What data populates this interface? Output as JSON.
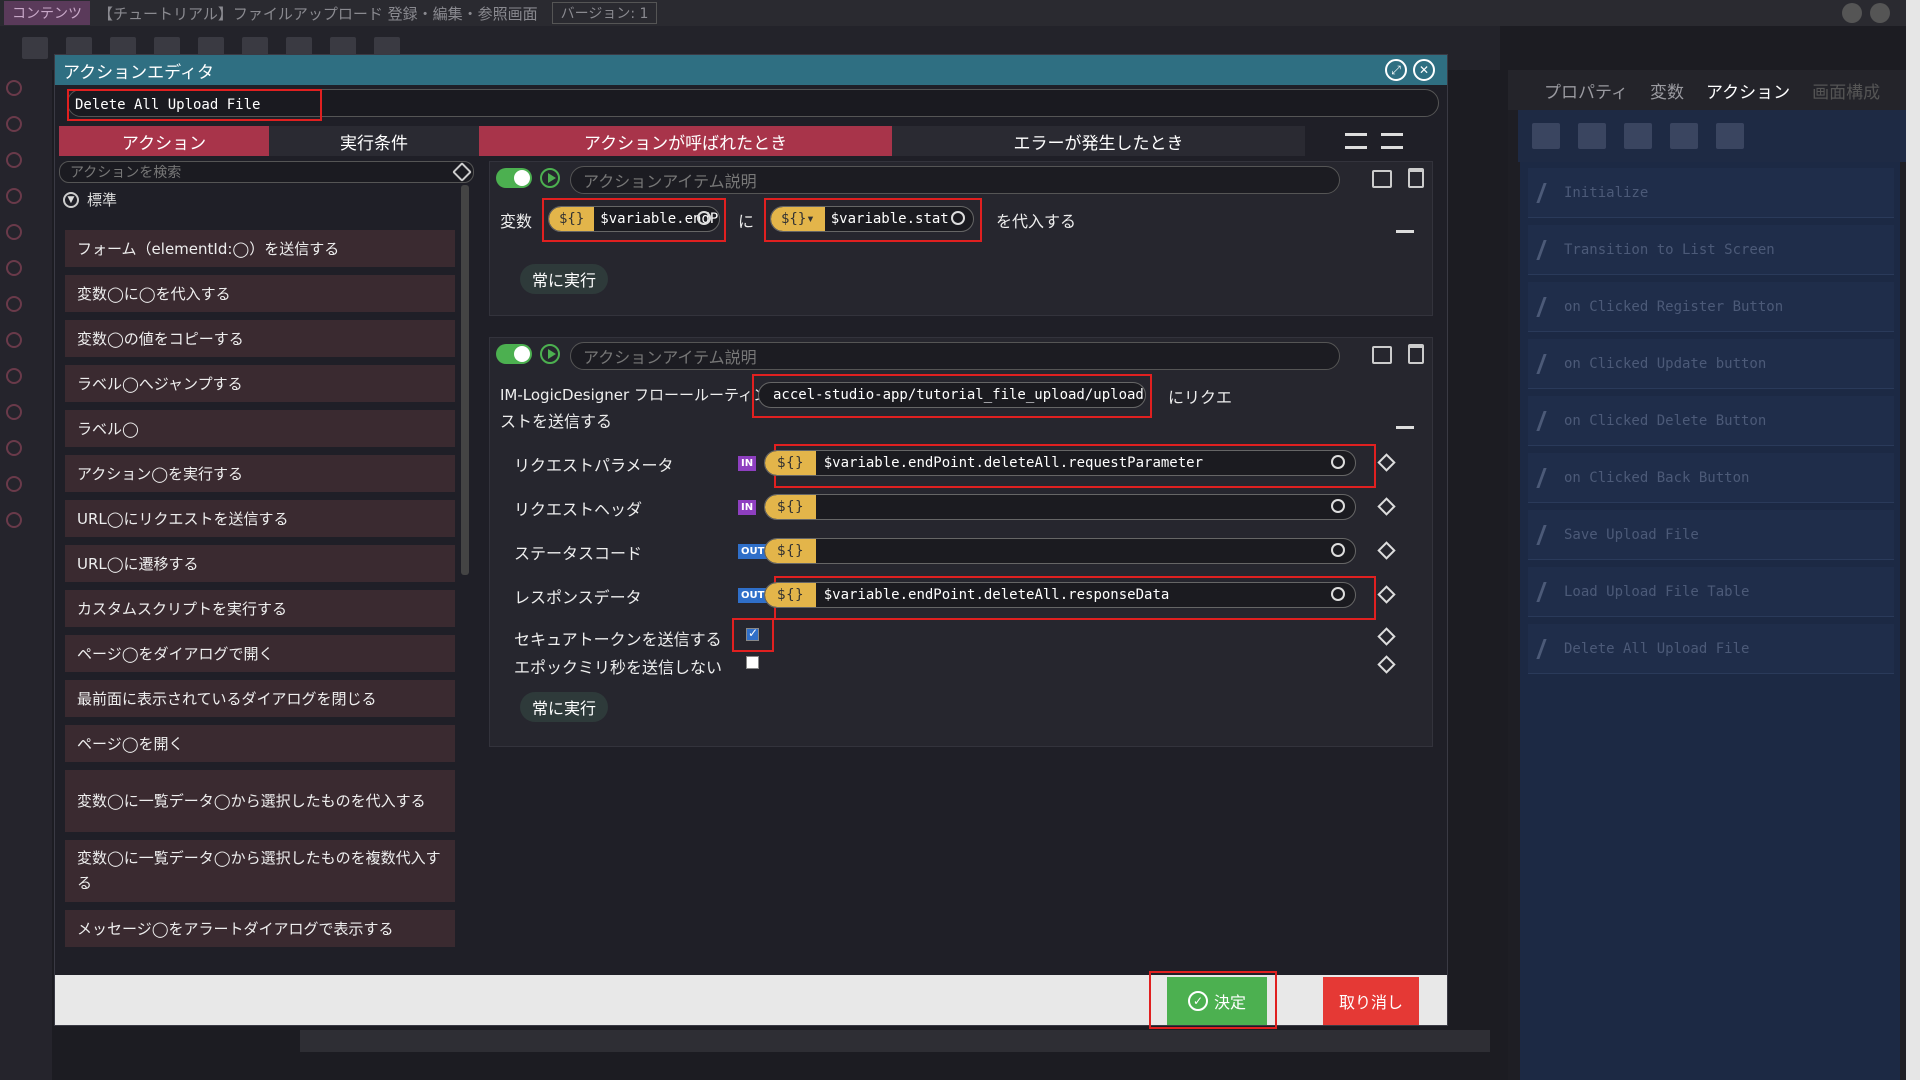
{
  "app": {
    "tag": "コンテンツ",
    "title": "【チュートリアル】ファイルアップロード 登録・編集・参照画面",
    "version": "バージョン: 1"
  },
  "right_panel": {
    "tabs": [
      "プロパティ",
      "変数",
      "アクション",
      "画面構成"
    ],
    "actions": [
      "Initialize",
      "Transition to List Screen",
      "on Clicked Register Button",
      "on Clicked Update button",
      "on Clicked Delete Button",
      "on Clicked Back Button",
      "Save Upload File",
      "Load Upload File Table",
      "Delete All Upload File"
    ]
  },
  "dialog": {
    "title": "アクションエディタ",
    "action_name": "Delete All Upload File",
    "left_tabs": [
      "アクション",
      "実行条件"
    ],
    "search_placeholder": "アクションを検索",
    "category": "標準",
    "action_items": [
      "フォーム（elementId:◯）を送信する",
      "変数◯に◯を代入する",
      "変数◯の値をコピーする",
      "ラベル◯へジャンプする",
      "ラベル◯",
      "アクション◯を実行する",
      "URL◯にリクエストを送信する",
      "URL◯に遷移する",
      "カスタムスクリプトを実行する",
      "ページ◯をダイアログで開く",
      "最前面に表示されているダイアログを閉じる",
      "ページ◯を開く",
      "変数◯に一覧データ◯から選択したものを代入する",
      "変数◯に一覧データ◯から選択したものを複数代入する",
      "メッセージ◯をアラートダイアログで表示する"
    ],
    "right_tabs": [
      "アクションが呼ばれたとき",
      "エラーが発生したとき"
    ],
    "card1": {
      "desc_placeholder": "アクションアイテム説明",
      "label_var": "変数",
      "var1": "$variable.endP",
      "label_ni": "に",
      "var2": "$variable.stat",
      "label_assign": "を代入する",
      "dollar": "${}",
      "run": "常に実行"
    },
    "card2": {
      "desc_placeholder": "アクションアイテム説明",
      "prefix": "IM-LogicDesigner フローールーティング",
      "route": "accel-studio-app/tutorial_file_upload/upload-files/all",
      "suffix1": "にリクエ",
      "suffix2": "ストを送信する",
      "params": [
        {
          "name": "リクエストパラメータ",
          "io": "IN",
          "value": "$variable.endPoint.deleteAll.requestParameter"
        },
        {
          "name": "リクエストヘッダ",
          "io": "IN",
          "value": ""
        },
        {
          "name": "ステータスコード",
          "io": "OUT",
          "value": ""
        },
        {
          "name": "レスポンスデータ",
          "io": "OUT",
          "value": "$variable.endPoint.deleteAll.responseData"
        }
      ],
      "secure_token": "セキュアトークンを送信する",
      "epoch": "エポックミリ秒を送信しない",
      "dollar": "${}",
      "run": "常に実行"
    },
    "ok": "決定",
    "cancel": "取り消し"
  }
}
